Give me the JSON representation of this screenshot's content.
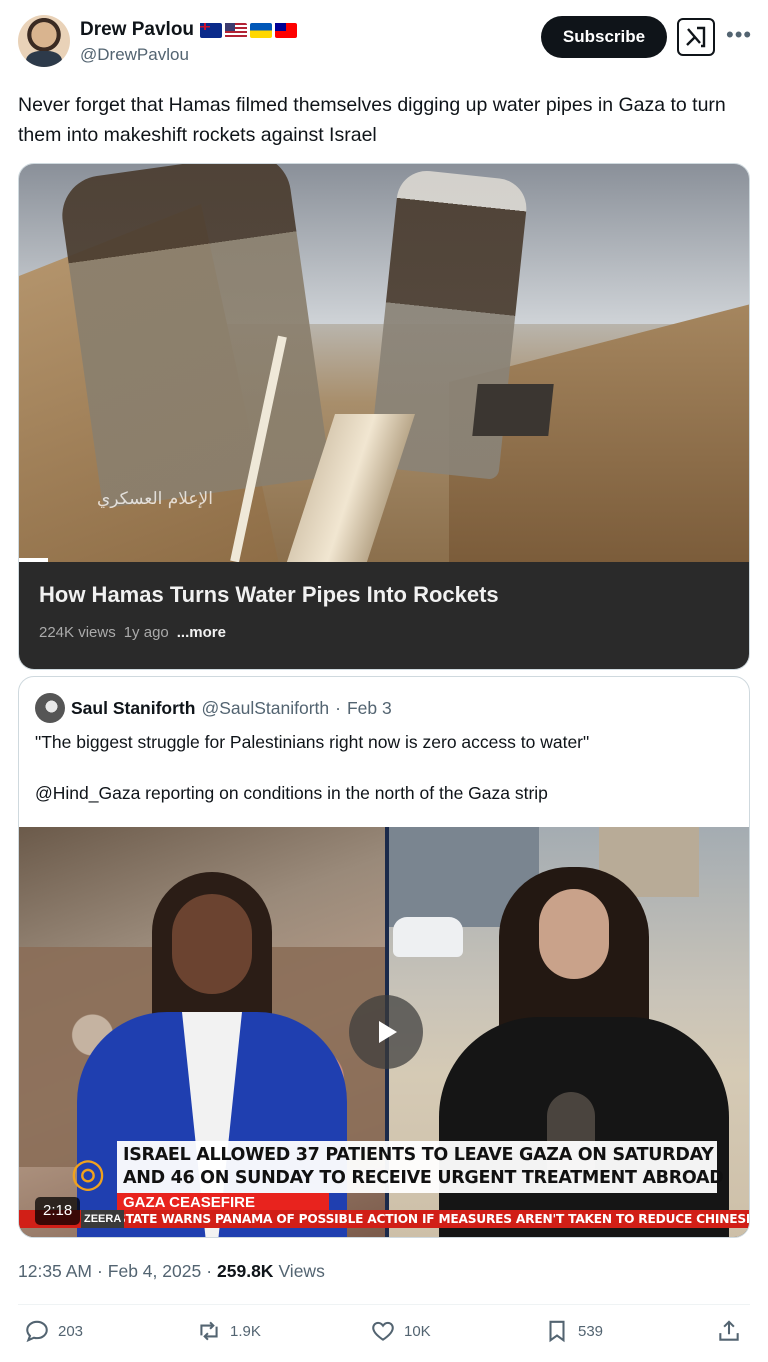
{
  "author": {
    "display_name": "Drew Pavlou",
    "handle": "@DrewPavlou",
    "flags": [
      "australia-flag",
      "usa-flag",
      "ukraine-flag",
      "taiwan-flag"
    ]
  },
  "header": {
    "subscribe_label": "Subscribe",
    "grok_icon": "grok-icon",
    "more_icon": "more-icon"
  },
  "tweet": {
    "text": "Never forget that Hamas filmed themselves digging up water pipes in Gaza to turn them into makeshift rockets against Israel"
  },
  "youtube_card": {
    "title": "How Hamas Turns Water Pipes Into Rockets",
    "views": "224K views",
    "age": "1y ago",
    "more": "...more",
    "watermark": "الإعلام العسكري",
    "progress": 0.04
  },
  "quoted_tweet": {
    "name": "Saul Staniforth",
    "handle": "@SaulStaniforth",
    "separator": "·",
    "date": "Feb 3",
    "text_line1": "\"The biggest struggle for Palestinians right now is zero access to water\"",
    "text_line2": "@Hind_Gaza reporting on conditions in the north of the Gaza strip",
    "video": {
      "headline_line1": "ISRAEL ALLOWED 37 PATIENTS TO LEAVE GAZA ON SATURDAY",
      "headline_line2": "AND 46 ON SUNDAY TO RECEIVE URGENT TREATMENT ABROAD",
      "tag": "GAZA CEASEFIRE",
      "ticker": "STATE WARNS PANAMA OF POSSIBLE ACTION IF MEASURES AREN'T TAKEN TO REDUCE CHINESE INFLU",
      "network_label": "ZEERA",
      "duration": "2:18",
      "play_icon": "play-icon"
    }
  },
  "meta": {
    "time": "12:35 AM",
    "dot": "·",
    "date": "Feb 4, 2025",
    "dot2": "·",
    "views_count": "259.8K",
    "views_label": "Views"
  },
  "actions": {
    "replies": "203",
    "reposts": "1.9K",
    "likes": "10K",
    "bookmarks": "539"
  },
  "colors": {
    "text": "#0f1419",
    "muted": "#536471",
    "border": "#cfd9de",
    "ticker_red": "#e8231e",
    "yt_info_bg": "#2a2a2a"
  }
}
